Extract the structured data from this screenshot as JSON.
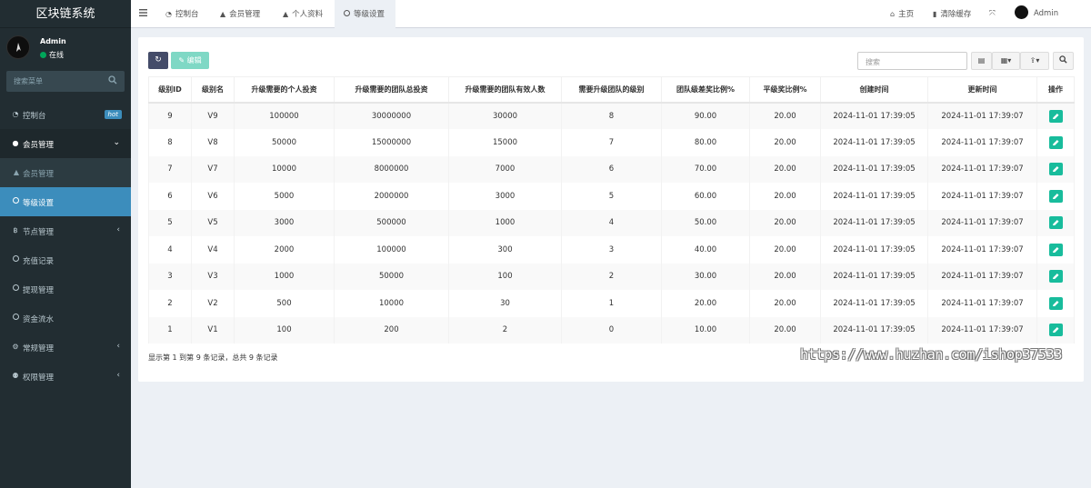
{
  "app": {
    "title": "区块链系统"
  },
  "user": {
    "name": "Admin",
    "status": "在线"
  },
  "sidebar": {
    "search_placeholder": "搜索菜单",
    "items": [
      {
        "label": "控制台",
        "icon": "dashboard-icon",
        "badge": "hot"
      },
      {
        "label": "会员管理",
        "icon": "user-circle-icon"
      },
      {
        "label": "会员管理",
        "icon": "user-icon"
      },
      {
        "label": "等级设置",
        "icon": "circle-icon"
      },
      {
        "label": "节点管理",
        "icon": "bitcoin-icon"
      },
      {
        "label": "充值记录",
        "icon": "circle-icon"
      },
      {
        "label": "提现管理",
        "icon": "circle-icon"
      },
      {
        "label": "资金流水",
        "icon": "circle-icon"
      },
      {
        "label": "常规管理",
        "icon": "cogs-icon"
      },
      {
        "label": "权限管理",
        "icon": "group-icon"
      }
    ]
  },
  "topbar": {
    "tabs": [
      {
        "label": "控制台"
      },
      {
        "label": "会员管理"
      },
      {
        "label": "个人资料"
      },
      {
        "label": "等级设置"
      }
    ],
    "home": "主页",
    "clear_cache": "清除缓存",
    "admin": "Admin"
  },
  "toolbar": {
    "edit_label": "编辑",
    "search_placeholder": "搜索"
  },
  "table": {
    "headers": [
      "级别ID",
      "级别名",
      "升级需要的个人投资",
      "升级需要的团队总投资",
      "升级需要的团队有效人数",
      "需要升级团队的级别",
      "团队级差奖比例%",
      "平级奖比例%",
      "创建时间",
      "更新时间",
      "操作"
    ],
    "rows": [
      [
        "9",
        "V9",
        "100000",
        "30000000",
        "30000",
        "8",
        "90.00",
        "20.00",
        "2024-11-01 17:39:05",
        "2024-11-01 17:39:07"
      ],
      [
        "8",
        "V8",
        "50000",
        "15000000",
        "15000",
        "7",
        "80.00",
        "20.00",
        "2024-11-01 17:39:05",
        "2024-11-01 17:39:07"
      ],
      [
        "7",
        "V7",
        "10000",
        "8000000",
        "7000",
        "6",
        "70.00",
        "20.00",
        "2024-11-01 17:39:05",
        "2024-11-01 17:39:07"
      ],
      [
        "6",
        "V6",
        "5000",
        "2000000",
        "3000",
        "5",
        "60.00",
        "20.00",
        "2024-11-01 17:39:05",
        "2024-11-01 17:39:07"
      ],
      [
        "5",
        "V5",
        "3000",
        "500000",
        "1000",
        "4",
        "50.00",
        "20.00",
        "2024-11-01 17:39:05",
        "2024-11-01 17:39:07"
      ],
      [
        "4",
        "V4",
        "2000",
        "100000",
        "300",
        "3",
        "40.00",
        "20.00",
        "2024-11-01 17:39:05",
        "2024-11-01 17:39:07"
      ],
      [
        "3",
        "V3",
        "1000",
        "50000",
        "100",
        "2",
        "30.00",
        "20.00",
        "2024-11-01 17:39:05",
        "2024-11-01 17:39:07"
      ],
      [
        "2",
        "V2",
        "500",
        "10000",
        "30",
        "1",
        "20.00",
        "20.00",
        "2024-11-01 17:39:05",
        "2024-11-01 17:39:07"
      ],
      [
        "1",
        "V1",
        "100",
        "200",
        "2",
        "0",
        "10.00",
        "20.00",
        "2024-11-01 17:39:05",
        "2024-11-01 17:39:07"
      ]
    ]
  },
  "pagination": {
    "info": "显示第 1 到第 9 条记录，总共 9 条记录"
  },
  "watermark": "https://www.huzhan.com/ishop37533",
  "colors": {
    "sidebar_bg": "#222d32",
    "active": "#3c8dbc",
    "edit": "#18bc9c",
    "refresh": "#444c69"
  }
}
